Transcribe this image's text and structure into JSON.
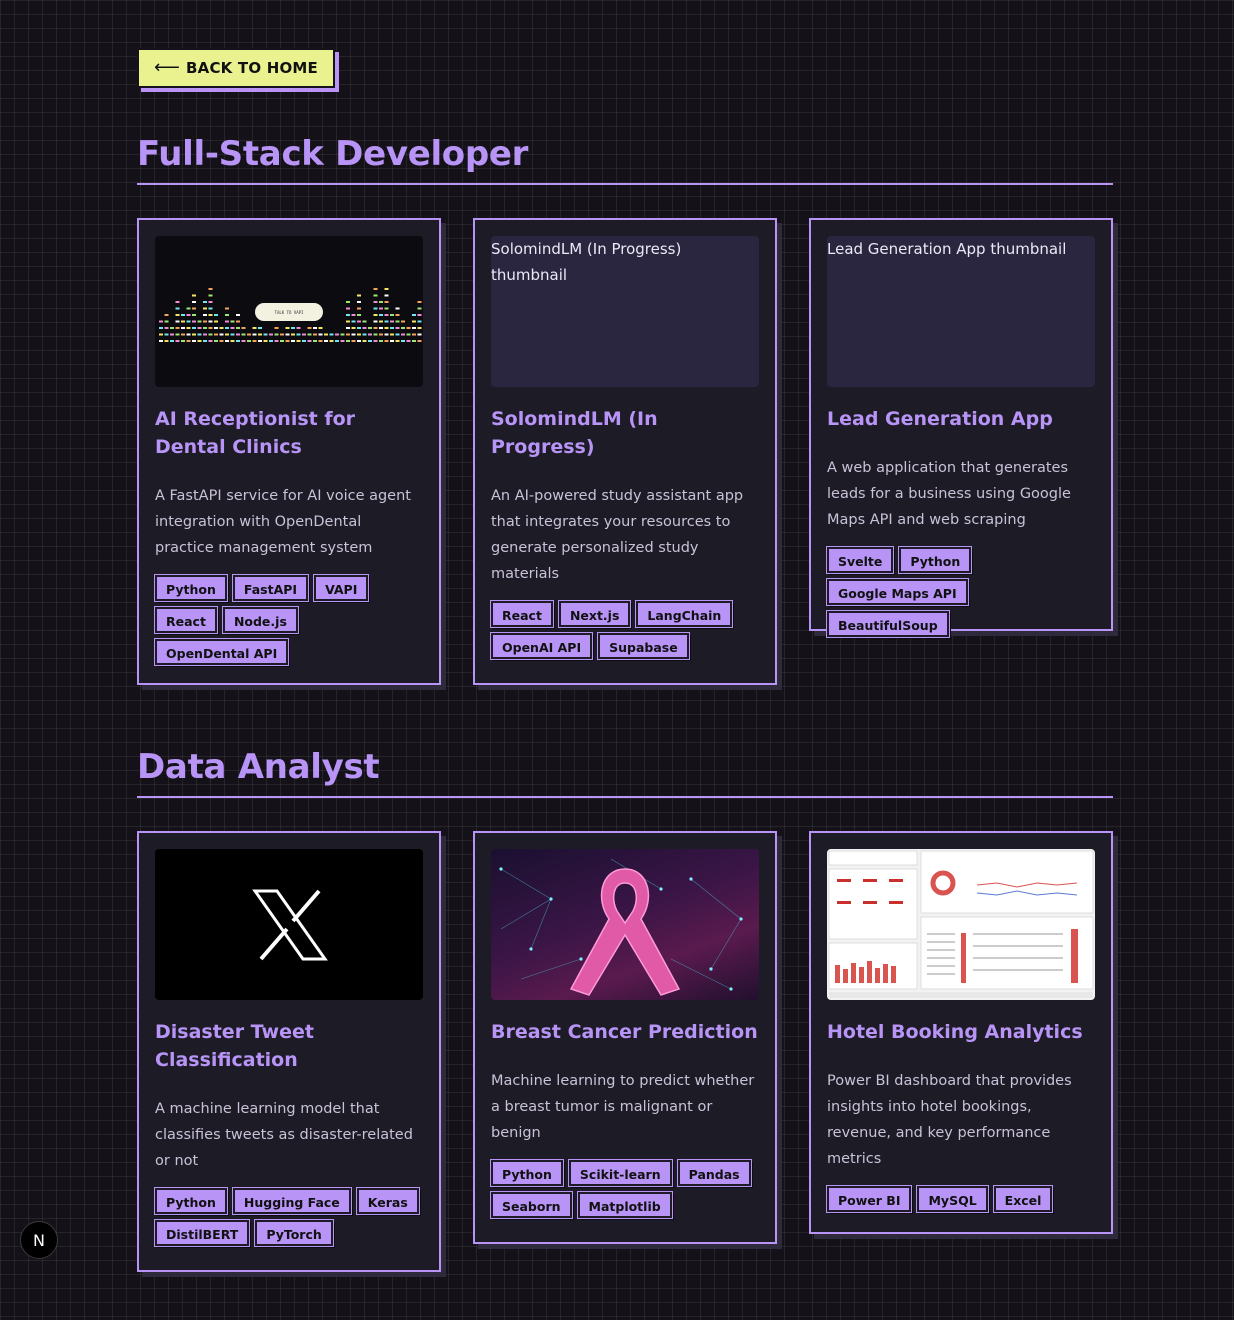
{
  "back_button": {
    "label": "BACK TO HOME",
    "icon": "arrow-left-icon"
  },
  "sections": [
    {
      "title": "Full-Stack Developer",
      "cards": [
        {
          "title": "AI Receptionist for Dental Clinics",
          "description": "A FastAPI service for AI voice agent integration with OpenDental practice management system",
          "thumbnail_caption": "TALK TO VAPI",
          "tags": [
            "Python",
            "FastAPI",
            "VAPI",
            "React",
            "Node.js",
            "OpenDental API"
          ]
        },
        {
          "title": "SolomindLM (In Progress)",
          "description": "An AI-powered study assistant app that integrates your resources to generate personalized study materials",
          "thumbnail_alt": "SolomindLM (In Progress) thumbnail",
          "tags": [
            "React",
            "Next.js",
            "LangChain",
            "OpenAI API",
            "Supabase"
          ]
        },
        {
          "title": "Lead Generation App",
          "description": "A web application that generates leads for a business using Google Maps API and web scraping",
          "thumbnail_alt": "Lead Generation App thumbnail",
          "tags": [
            "Svelte",
            "Python",
            "Google Maps API",
            "BeautifulSoup"
          ]
        }
      ]
    },
    {
      "title": "Data Analyst",
      "cards": [
        {
          "title": "Disaster Tweet Classification",
          "description": "A machine learning model that classifies tweets as disaster-related or not",
          "thumbnail_icon": "x-logo-icon",
          "tags": [
            "Python",
            "Hugging Face",
            "Keras",
            "DistilBERT",
            "PyTorch"
          ]
        },
        {
          "title": "Breast Cancer Prediction",
          "description": "Machine learning to predict whether a breast tumor is malignant or benign",
          "thumbnail_icon": "pink-ribbon-icon",
          "tags": [
            "Python",
            "Scikit-learn",
            "Pandas",
            "Seaborn",
            "Matplotlib"
          ]
        },
        {
          "title": "Hotel Booking Analytics",
          "description": "Power BI dashboard that provides insights into hotel bookings, revenue, and key performance metrics",
          "thumbnail_icon": "dashboard-icon",
          "tags": [
            "Power BI",
            "MySQL",
            "Excel"
          ]
        }
      ]
    }
  ],
  "nextjs_badge": {
    "label": "N"
  },
  "colors": {
    "accent": "#b794f6",
    "button": "#eaf28f",
    "card_bg": "#1d1b26",
    "page_bg": "#141218"
  }
}
